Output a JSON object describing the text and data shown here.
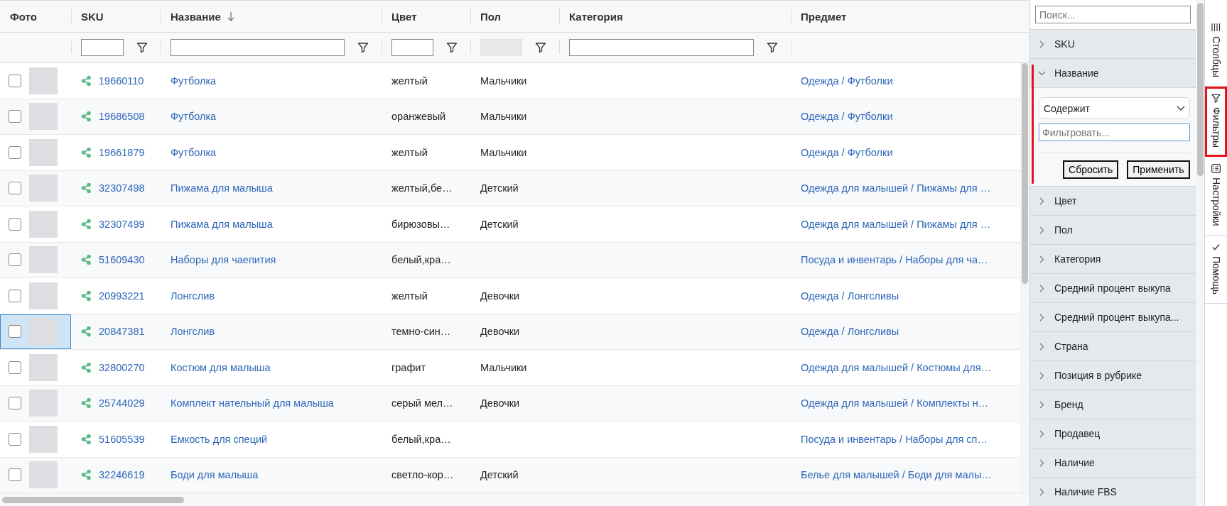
{
  "table": {
    "columns": [
      {
        "label": "Фото",
        "sorted": false,
        "has_filter": false
      },
      {
        "label": "SKU",
        "sorted": false,
        "has_filter": true,
        "filter_disabled": false
      },
      {
        "label": "Название",
        "sorted": true,
        "has_filter": true,
        "filter_disabled": false
      },
      {
        "label": "Цвет",
        "sorted": false,
        "has_filter": true,
        "filter_disabled": false
      },
      {
        "label": "Пол",
        "sorted": false,
        "has_filter": true,
        "filter_disabled": true
      },
      {
        "label": "Категория",
        "sorted": false,
        "has_filter": true,
        "filter_disabled": false
      },
      {
        "label": "Предмет",
        "sorted": false,
        "has_filter": false
      }
    ],
    "rows": [
      {
        "checked": false,
        "focused": false,
        "sku": "19660110",
        "name": "Футболка",
        "color_label": "желтый",
        "gender": "Мальчики",
        "subject": "Одежда / Футболки"
      },
      {
        "checked": false,
        "focused": false,
        "sku": "19686508",
        "name": "Футболка",
        "color_label": "оранжевый",
        "gender": "Мальчики",
        "subject": "Одежда / Футболки"
      },
      {
        "checked": false,
        "focused": false,
        "sku": "19661879",
        "name": "Футболка",
        "color_label": "желтый",
        "gender": "Мальчики",
        "subject": "Одежда / Футболки"
      },
      {
        "checked": false,
        "focused": false,
        "sku": "32307498",
        "name": "Пижама для малыша",
        "color_label": "желтый,бе…",
        "gender": "Детский",
        "subject": "Одежда для малышей / Пижамы для …"
      },
      {
        "checked": false,
        "focused": false,
        "sku": "32307499",
        "name": "Пижама для малыша",
        "color_label": "бирюзовы…",
        "gender": "Детский",
        "subject": "Одежда для малышей / Пижамы для …"
      },
      {
        "checked": false,
        "focused": false,
        "sku": "51609430",
        "name": "Наборы для чаепития",
        "color_label": "белый,кра…",
        "subject": "Посуда и инвентарь / Наборы для ча…"
      },
      {
        "checked": false,
        "focused": false,
        "sku": "20993221",
        "name": "Лонгслив",
        "color_label": "желтый",
        "gender": "Девочки",
        "subject": "Одежда / Лонгсливы"
      },
      {
        "checked": false,
        "focused": true,
        "sku": "20847381",
        "name": "Лонгслив",
        "color_label": "темно-син…",
        "gender": "Девочки",
        "subject": "Одежда / Лонгсливы"
      },
      {
        "checked": false,
        "focused": false,
        "sku": "32800270",
        "name": "Костюм для малыша",
        "color_label": "графит",
        "gender": "Мальчики",
        "subject": "Одежда для малышей / Костюмы для…"
      },
      {
        "checked": false,
        "focused": false,
        "sku": "25744029",
        "name": "Комплект нательный для малыша",
        "color_label": "серый мел…",
        "gender": "Девочки",
        "subject": "Одежда для малышей / Комплекты н…"
      },
      {
        "checked": false,
        "focused": false,
        "sku": "51605539",
        "name": "Емкость для специй",
        "color_label": "белый,кра…",
        "subject": "Посуда и инвентарь / Наборы для сп…"
      },
      {
        "checked": false,
        "focused": false,
        "sku": "32246619",
        "name": "Боди для малыша",
        "color_label": "светло-кор…",
        "gender": "Детский",
        "subject": "Белье для малышей / Боди для малы…"
      }
    ]
  },
  "filter_panel": {
    "search": {
      "placeholder": "Поиск..."
    },
    "groups": [
      {
        "label": "SKU",
        "expanded": false,
        "highlighted": false
      },
      {
        "label": "Название",
        "expanded": true,
        "highlighted": true,
        "operator": "Содержит",
        "placeholder": "Фильтровать...",
        "buttons": [
          "Сбросить",
          "Применить"
        ]
      },
      {
        "label": "Цвет",
        "expanded": false,
        "highlighted": false
      },
      {
        "label": "Пол",
        "expanded": false,
        "highlighted": false
      },
      {
        "label": "Категория",
        "expanded": false,
        "highlighted": false
      },
      {
        "label": "Средний процент выкупа",
        "expanded": false,
        "highlighted": false
      },
      {
        "label": "Средний процент выкупа...",
        "expanded": false,
        "highlighted": false
      },
      {
        "label": "Страна",
        "expanded": false,
        "highlighted": false
      },
      {
        "label": "Позиция в рубрике",
        "expanded": false,
        "highlighted": false
      },
      {
        "label": "Бренд",
        "expanded": false,
        "highlighted": false
      },
      {
        "label": "Продавец",
        "expanded": false,
        "highlighted": false
      },
      {
        "label": "Наличие",
        "expanded": false,
        "highlighted": false
      },
      {
        "label": "Наличие FBS",
        "expanded": false,
        "highlighted": false
      }
    ]
  },
  "side_tabs": [
    {
      "label": "Столбцы",
      "kind": "columns",
      "selected": false
    },
    {
      "label": "Фильтры",
      "kind": "filter",
      "selected": true
    },
    {
      "label": "Настройки",
      "kind": "settings",
      "selected": false
    },
    {
      "label": "Помощь",
      "kind": "help",
      "selected": false
    }
  ]
}
